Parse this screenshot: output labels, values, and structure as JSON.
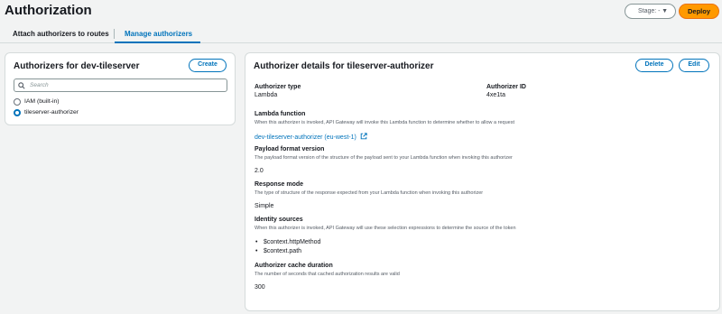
{
  "page": {
    "title": "Authorization"
  },
  "header": {
    "stage_label": "Stage: -",
    "deploy_label": "Deploy"
  },
  "tabs": [
    {
      "label": "Attach authorizers to routes",
      "active": false
    },
    {
      "label": "Manage authorizers",
      "active": true
    }
  ],
  "left_panel": {
    "title": "Authorizers for dev-tileserver",
    "create_label": "Create",
    "search_placeholder": "Search",
    "options": [
      {
        "label": "IAM (built-in)",
        "selected": false
      },
      {
        "label": "tileserver-authorizer",
        "selected": true
      }
    ]
  },
  "details": {
    "title": "Authorizer details for tileserver-authorizer",
    "delete_label": "Delete",
    "edit_label": "Edit",
    "type_label": "Authorizer type",
    "type_value": "Lambda",
    "id_label": "Authorizer ID",
    "id_value": "4xe1ta",
    "lambda_label": "Lambda function",
    "lambda_desc": "When this authorizer is invoked, API Gateway will invoke this Lambda function to determine whether to allow a request",
    "lambda_link": "dev-tileserver-authorizer (eu-west-1)",
    "payload_label": "Payload format version",
    "payload_desc": "The payload format version of the structure of the payload sent to your Lambda function when invoking this authorizer",
    "payload_value": "2.0",
    "response_label": "Response mode",
    "response_desc": "The type of structure of the response expected from your Lambda function when invoking this authorizer",
    "response_value": "Simple",
    "identity_label": "Identity sources",
    "identity_desc": "When this authorizer is invoked, API Gateway will use these selection expressions to determine the source of the token",
    "identity_values": [
      "$context.httpMethod",
      "$context.path"
    ],
    "cache_label": "Authorizer cache duration",
    "cache_desc": "The number of seconds that cached authorization results are valid",
    "cache_value": "300"
  },
  "colors": {
    "accent": "#0073bb",
    "deploy": "#ff9900",
    "background": "#f2f3f3"
  }
}
